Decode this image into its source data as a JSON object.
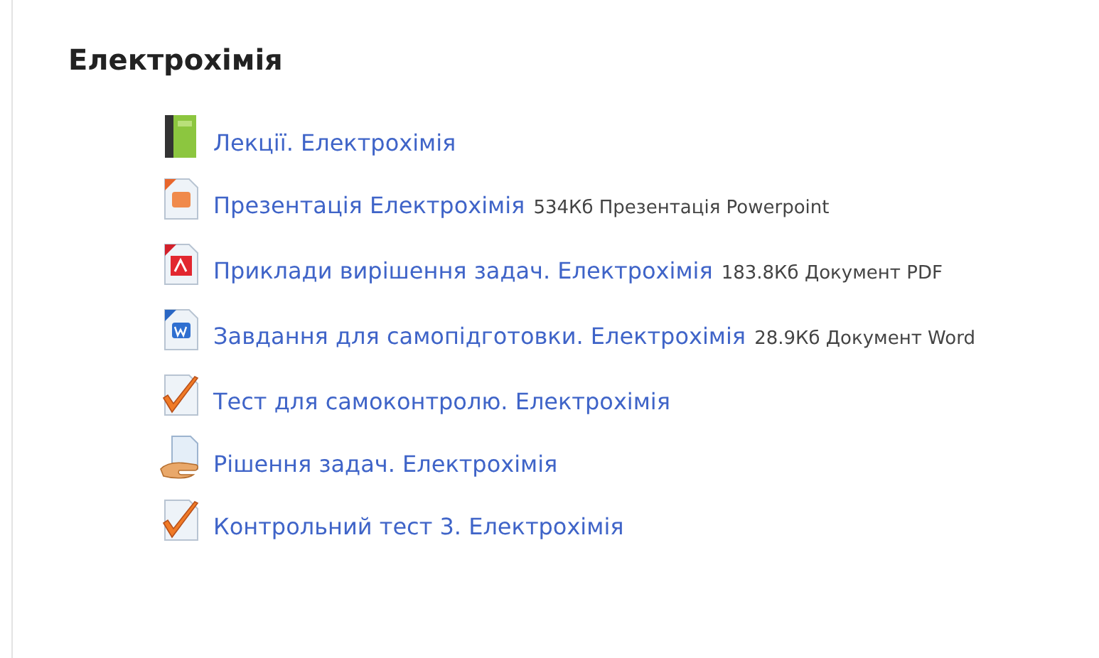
{
  "section": {
    "title": "Електрохімія",
    "activities": [
      {
        "kind": "book",
        "name": "Лекції. Електрохімія"
      },
      {
        "kind": "powerpoint",
        "name": "Презентація Електрохімія",
        "details": "534Кб Презентація Powerpoint"
      },
      {
        "kind": "pdf",
        "name": "Приклади вирішення задач. Електрохімія",
        "details": "183.8Кб Документ PDF"
      },
      {
        "kind": "word",
        "name": "Завдання для самопідготовки. Електрохімія",
        "details": "28.9Кб Документ Word"
      },
      {
        "kind": "quiz",
        "name": "Тест для самоконтролю. Електрохімія"
      },
      {
        "kind": "assignment",
        "name": "Рішення задач. Електрохімія"
      },
      {
        "kind": "quiz",
        "name": "Контрольний тест 3. Електрохімія"
      }
    ]
  }
}
